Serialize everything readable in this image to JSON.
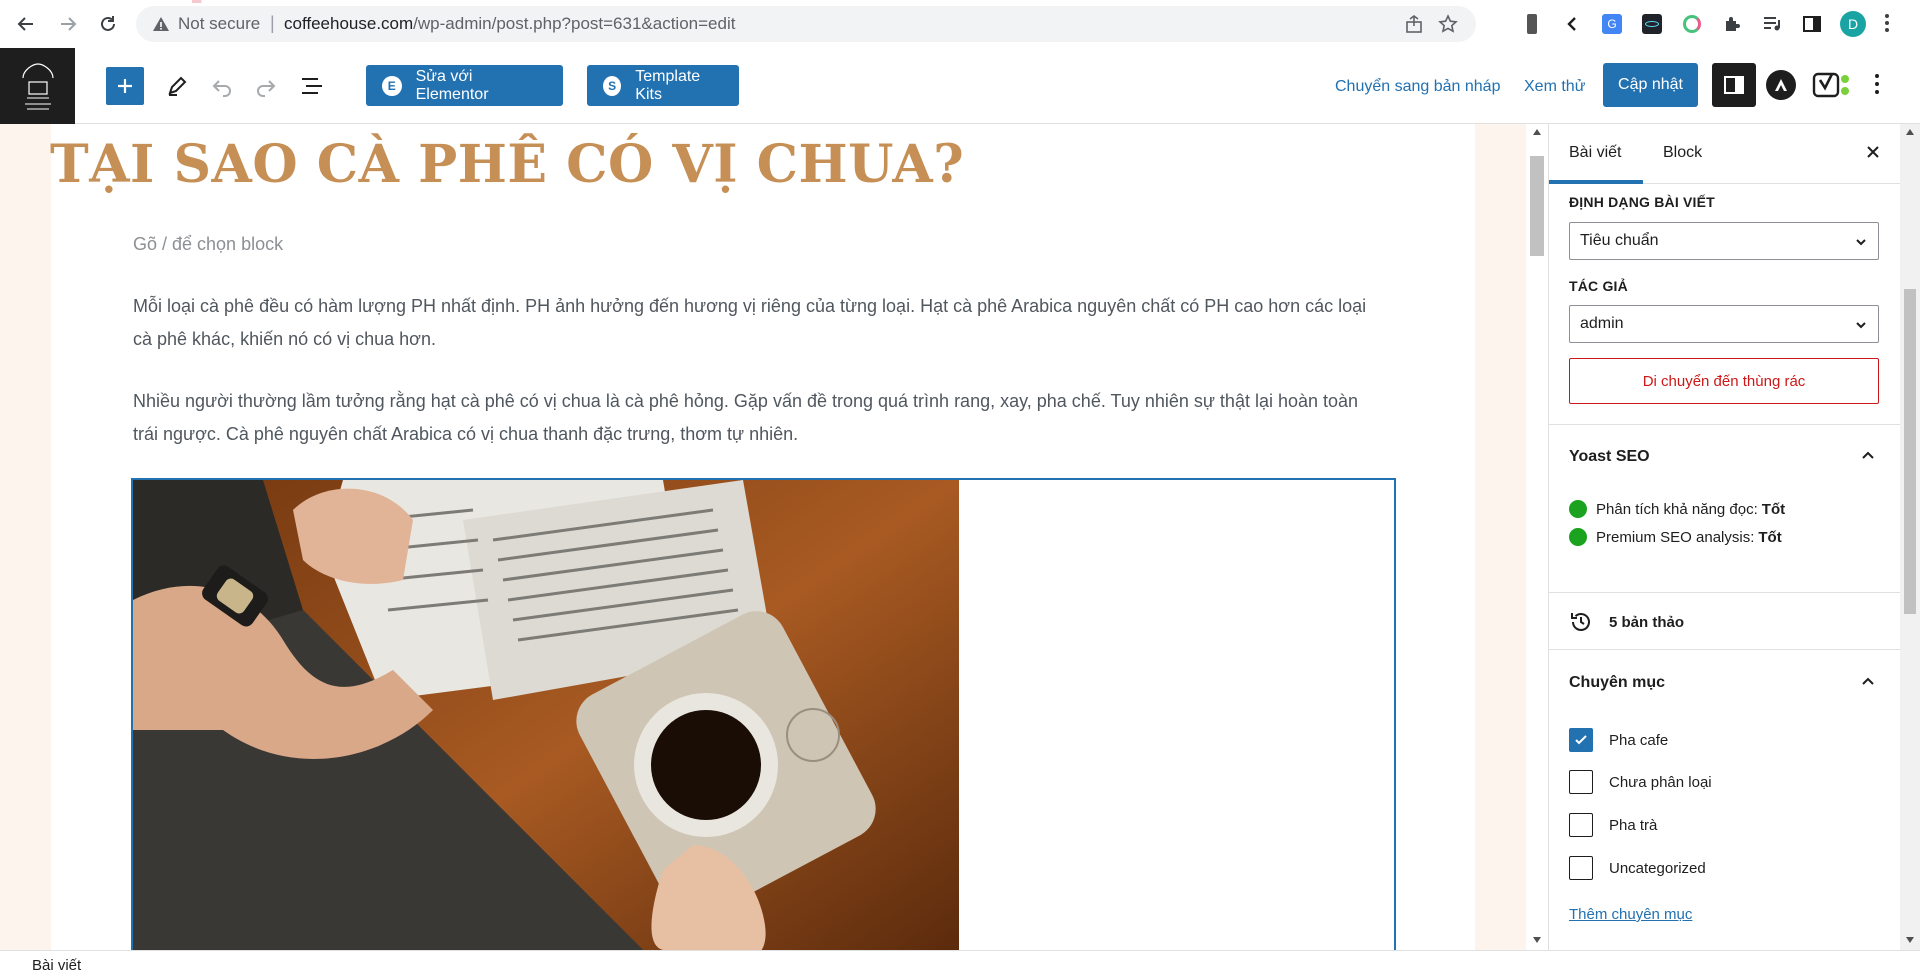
{
  "browser": {
    "security_label": "Not secure",
    "url_host": "coffeehouse.com",
    "url_path": "/wp-admin/post.php?post=631&action=edit",
    "profile_initial": "D",
    "profile_color": "#1aa3a3"
  },
  "toolbar": {
    "elementor_label": "Sửa với Elementor",
    "template_kits_label": "Template Kits",
    "switch_draft_label": "Chuyển sang bản nháp",
    "preview_label": "Xem thử",
    "update_label": "Cập nhật",
    "accent_color": "#2271b1"
  },
  "editor": {
    "title": "TẠI SAO CÀ PHÊ CÓ VỊ CHUA?",
    "title_color": "#c58f55",
    "block_placeholder": "Gõ / để chọn block",
    "paragraphs": [
      "Mỗi loại cà phê đều có hàm lượng PH nhất định. PH ảnh hưởng đến hương vị riêng của từng loại. Hạt cà phê Arabica nguyên chất có PH cao hơn các loại cà phê khác, khiến nó có vị chua hơn.",
      "Nhiều người thường lầm tưởng rằng hạt cà phê có vị chua là cà phê hỏng. Gặp vấn đề trong quá trình rang, xay, pha chế. Tuy nhiên sự thật lại hoàn toàn trái ngược. Cà phê nguyên chất Arabica có vị chua thanh đặc trưng, thơm tự nhiên."
    ]
  },
  "sidebar": {
    "tabs": [
      "Bài viết",
      "Block"
    ],
    "format_label": "ĐỊNH DẠNG BÀI VIẾT",
    "format_value": "Tiêu chuẩn",
    "author_label": "TÁC GIẢ",
    "author_value": "admin",
    "trash_label": "Di chuyển đến thùng rác",
    "yoast": {
      "title": "Yoast SEO",
      "readability_label": "Phân tích khả năng đọc:",
      "readability_value": "Tốt",
      "premium_label": "Premium SEO analysis:",
      "premium_value": "Tốt",
      "status_color": "#1ba31f"
    },
    "revisions_label": "5 bản thảo",
    "categories": {
      "title": "Chuyên mục",
      "items": [
        {
          "label": "Pha cafe",
          "checked": true
        },
        {
          "label": "Chưa phân loại",
          "checked": false
        },
        {
          "label": "Pha trà",
          "checked": false
        },
        {
          "label": "Uncategorized",
          "checked": false
        }
      ],
      "add_label": "Thêm chuyên mục"
    }
  },
  "footer": {
    "breadcrumb": "Bài viết"
  }
}
